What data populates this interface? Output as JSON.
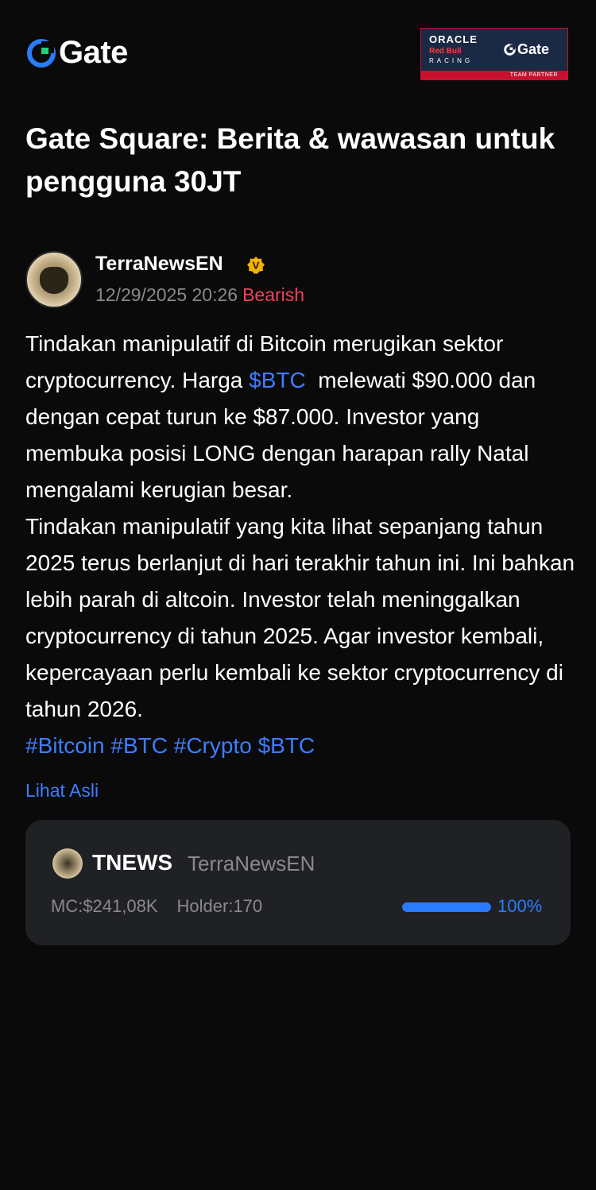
{
  "header": {
    "brand": "Gate",
    "partner": {
      "line1": "ORACLE",
      "line2": "Red Bull",
      "line3": "RACING",
      "brand": "Gate",
      "strip": "TEAM PARTNER"
    }
  },
  "title": "Gate Square: Berita & wawasan untuk pengguna 30JT",
  "post": {
    "author": "TerraNewsEN",
    "timestamp": "12/29/2025 20:26",
    "sentiment": "Bearish",
    "body_1a": "Tindakan manipulatif di Bitcoin merugikan sektor cryptocurrency. Harga ",
    "cashtag": "$BTC",
    "body_1b": "  melewati $90.000 dan dengan cepat turun ke $87.000. Investor yang membuka posisi LONG dengan harapan rally Natal mengalami kerugian besar.",
    "body_2": "Tindakan manipulatif yang kita lihat sepanjang tahun 2025 terus berlanjut di hari terakhir tahun ini. Ini bahkan lebih parah di altcoin. Investor telah meninggalkan cryptocurrency di tahun 2025. Agar investor kembali, kepercayaan perlu kembali ke sektor cryptocurrency di tahun 2026.",
    "tags": "#Bitcoin #BTC #Crypto $BTC",
    "view_original": "Lihat Asli"
  },
  "token": {
    "symbol": "TNEWS",
    "name": "TerraNewsEN",
    "market_cap": "MC:$241,08K",
    "holders": "Holder:170",
    "progress_label": "100%",
    "progress_fraction": 1.0
  },
  "colors": {
    "background": "#0a0a0a",
    "accent_blue": "#3d7dff",
    "bearish_red": "#f0425c",
    "card": "#1f2125"
  }
}
